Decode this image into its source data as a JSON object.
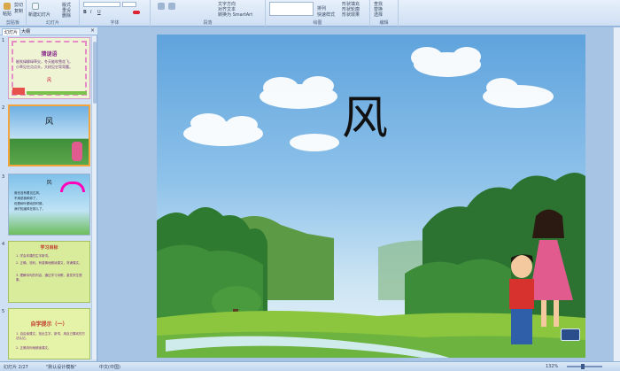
{
  "ribbon": {
    "groups": [
      {
        "label": "剪贴板"
      },
      {
        "label": "幻灯片"
      },
      {
        "label": "字体"
      },
      {
        "label": "段落"
      },
      {
        "label": "绘图"
      },
      {
        "label": "编辑"
      }
    ],
    "items": {
      "paste": "粘贴",
      "cut": "剪切",
      "copy": "复制",
      "new_slide": "新建幻灯片",
      "layout": "版式",
      "reset": "重设",
      "delete": "删除",
      "text_direction": "文字方向",
      "align_text": "对齐文本",
      "convert_smartart": "转换为 SmartArt",
      "arrange": "排列",
      "quick_styles": "快速样式",
      "shape_fill": "形状填充",
      "shape_outline": "形状轮廓",
      "shape_effects": "形状效果",
      "find": "查找",
      "replace": "替换",
      "select": "选择"
    }
  },
  "panel": {
    "tabs": [
      "幻灯片",
      "大纲"
    ],
    "close": "×",
    "thumbnails": [
      {
        "num": "1",
        "title": "猜谜语",
        "lines": [
          "能吹绿柳绿草尖，冬天能吹雪花飞，",
          "小草见它点点头，大树见它弯弯腰。"
        ],
        "answer": "风"
      },
      {
        "num": "2",
        "title": "风"
      },
      {
        "num": "3",
        "title": "风",
        "lines": [
          "谁也没有看见过风，",
          "不用说我和你了，",
          "但是树叶颤动的时候，",
          "我们知道风在那儿了。"
        ]
      },
      {
        "num": "4",
        "title": "学习目标",
        "lines": [
          "1. 学会本课的生字新词。",
          "2. 正确、流利、有感情地朗读课文，背诵课文。",
          "3. 理解诗句的内容，通过学习诗歌，激发学生想象。"
        ]
      },
      {
        "num": "5",
        "title": "自学提示（一）",
        "lines": [
          "1. 自由读课文，找出生字、新词，用自己喜欢的方法认记。",
          "2. 正确流利地朗读课文。"
        ]
      }
    ]
  },
  "slide": {
    "title": "风"
  },
  "status": {
    "slide_info": "幻灯片 2/27",
    "theme": "\"默认设计模板\"",
    "language": "中文(中国)",
    "zoom": "132%"
  }
}
